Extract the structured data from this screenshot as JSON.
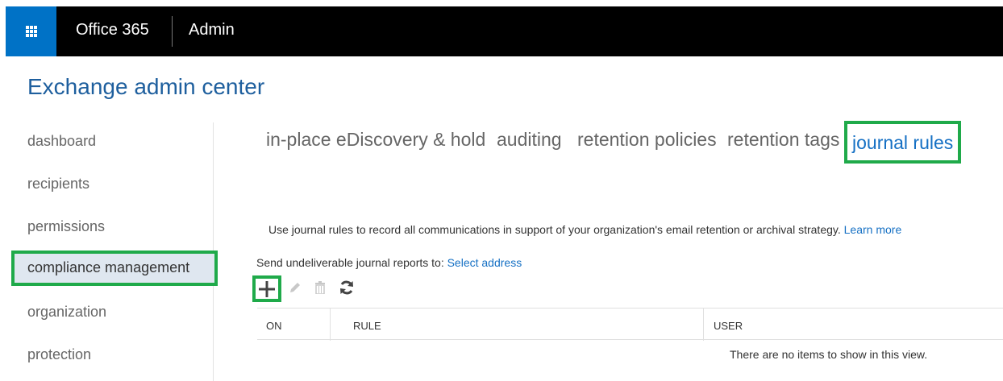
{
  "suite": {
    "product": "Office 365",
    "section": "Admin",
    "waffle_icon": "app-launcher-icon",
    "accent": "#0072c6"
  },
  "page": {
    "title": "Exchange admin center"
  },
  "nav": {
    "items": [
      {
        "label": "dashboard",
        "selected": false
      },
      {
        "label": "recipients",
        "selected": false
      },
      {
        "label": "permissions",
        "selected": false
      },
      {
        "label": "compliance management",
        "selected": true
      },
      {
        "label": "organization",
        "selected": false
      },
      {
        "label": "protection",
        "selected": false
      }
    ]
  },
  "tabs": [
    {
      "label": "in-place eDiscovery & hold",
      "active": false
    },
    {
      "label": "auditing",
      "active": false
    },
    {
      "label": "retention policies",
      "active": false
    },
    {
      "label": "retention tags",
      "active": false
    },
    {
      "label": "journal rules",
      "active": true
    }
  ],
  "content": {
    "description": "Use journal rules to record all communications in support of your organization's email retention or archival strategy.",
    "learn_more": "Learn more",
    "send_label": "Send undeliverable journal reports to:",
    "select_address": "Select address"
  },
  "toolbar": {
    "add_icon": "plus-icon",
    "edit_icon": "pencil-icon",
    "delete_icon": "trash-icon",
    "refresh_icon": "refresh-icon"
  },
  "table": {
    "columns": [
      "ON",
      "RULE",
      "USER"
    ],
    "empty_message": "There are no items to show in this view."
  },
  "colors": {
    "highlight": "#1faa4a",
    "link": "#1570c4",
    "title": "#1e5f9e"
  }
}
